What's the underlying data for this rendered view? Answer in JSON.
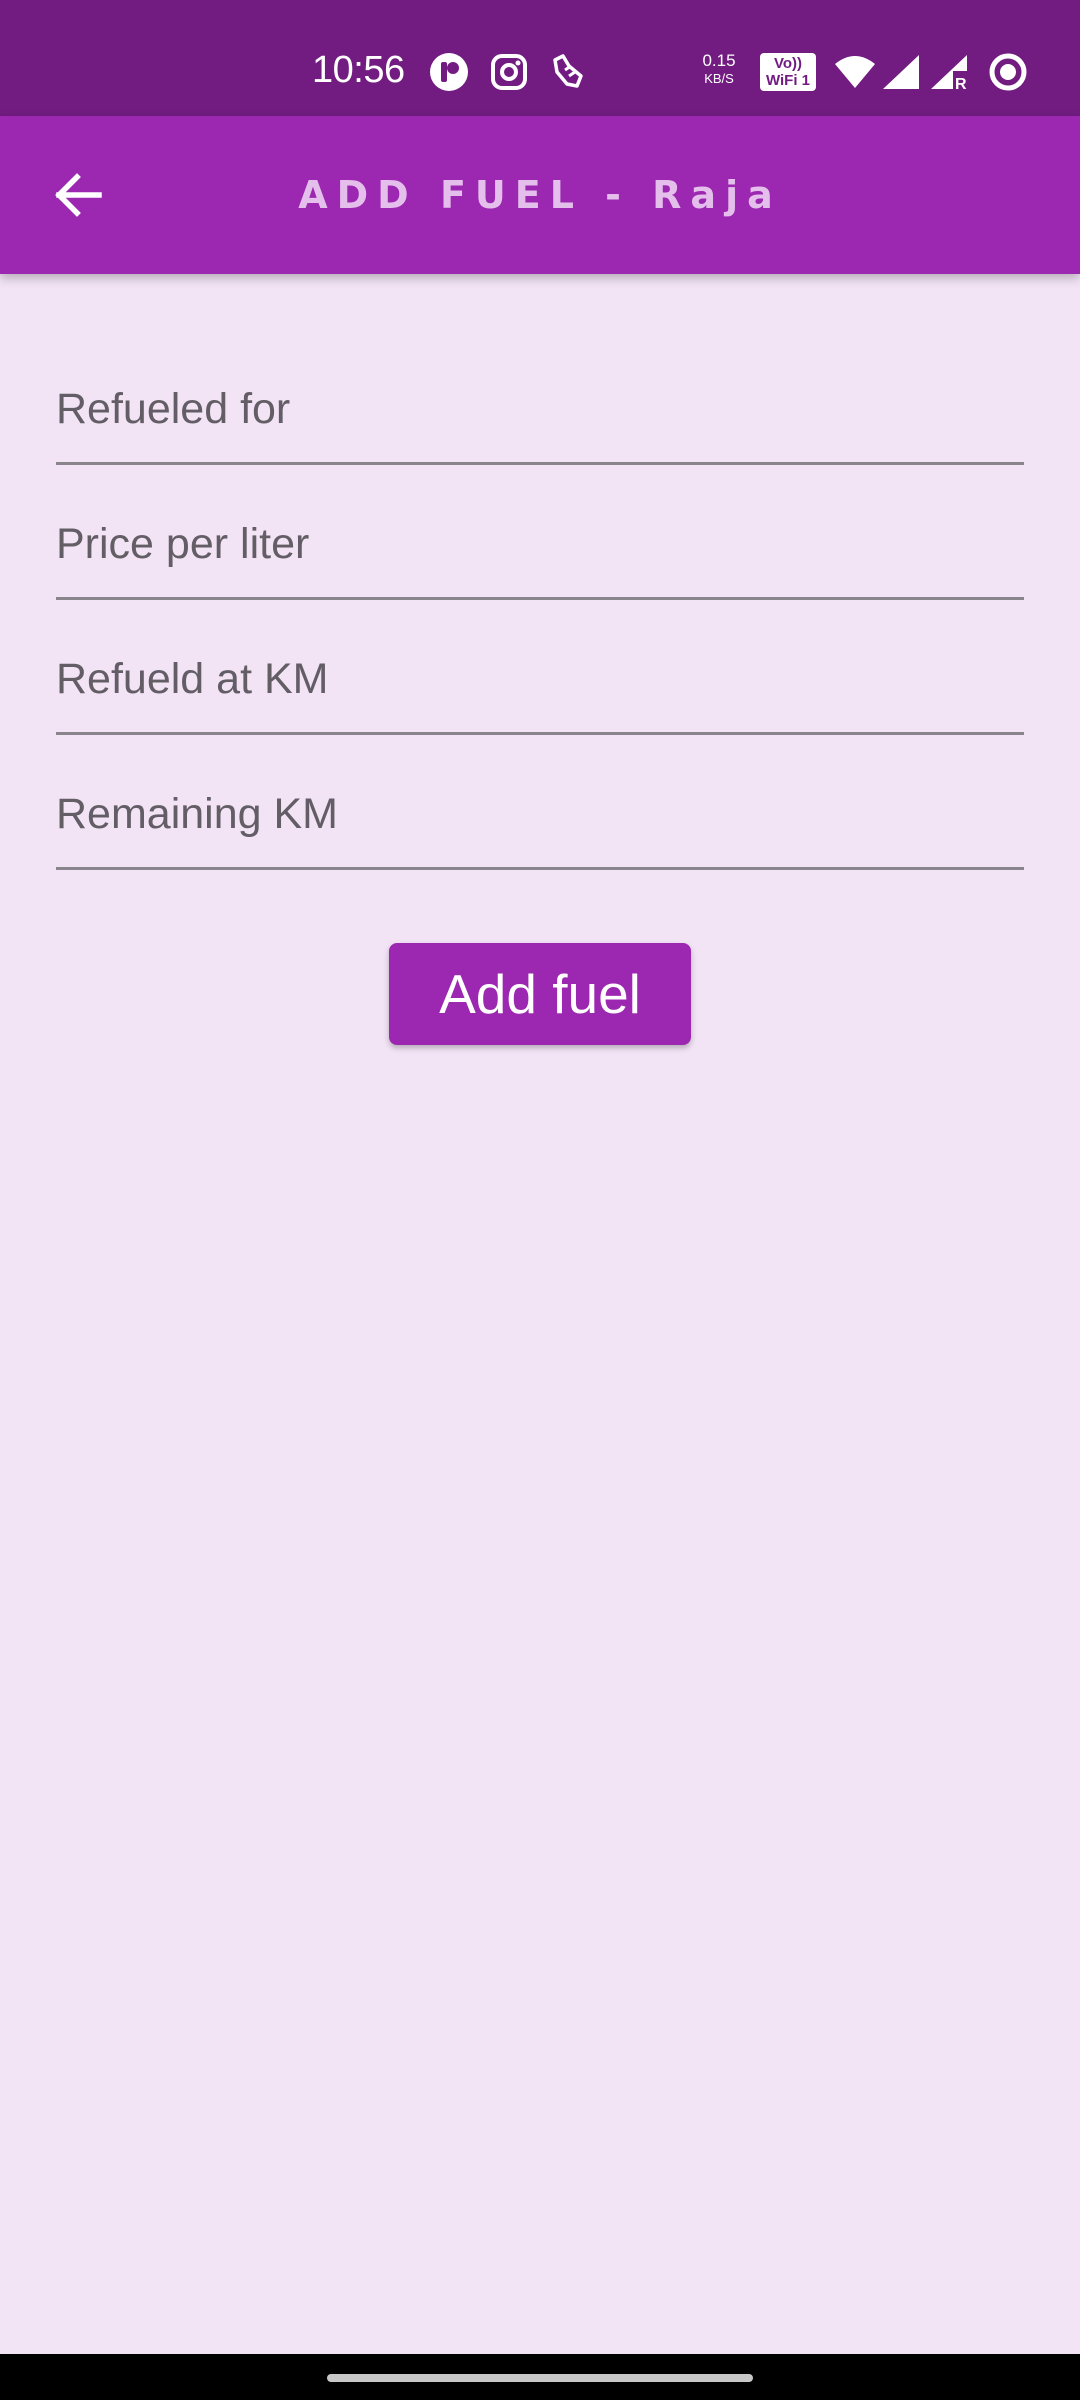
{
  "status_bar": {
    "time": "10:56",
    "net_speed_value": "0.15",
    "net_speed_unit": "KB/S",
    "volte_line1": "Vo))",
    "volte_line2": "WiFi 1",
    "icons": [
      "app-notification-icon",
      "instagram-icon",
      "fitness-icon",
      "wifi-icon",
      "signal-icon",
      "signal-roaming-icon",
      "battery-ring-icon"
    ]
  },
  "app_bar": {
    "title": "ADD FUEL - Raja",
    "back_icon": "arrow-left-icon"
  },
  "form": {
    "fields": [
      {
        "placeholder": "Refueled for",
        "value": ""
      },
      {
        "placeholder": "Price per liter",
        "value": ""
      },
      {
        "placeholder": "Refueld at KM",
        "value": ""
      },
      {
        "placeholder": "Remaining KM",
        "value": ""
      }
    ],
    "submit_label": "Add fuel"
  },
  "colors": {
    "status_bar": "#721c82",
    "app_bar": "#9c27b0",
    "background": "#f2e4f5",
    "title_text": "#e5bfeb",
    "button": "#9c27b0"
  }
}
